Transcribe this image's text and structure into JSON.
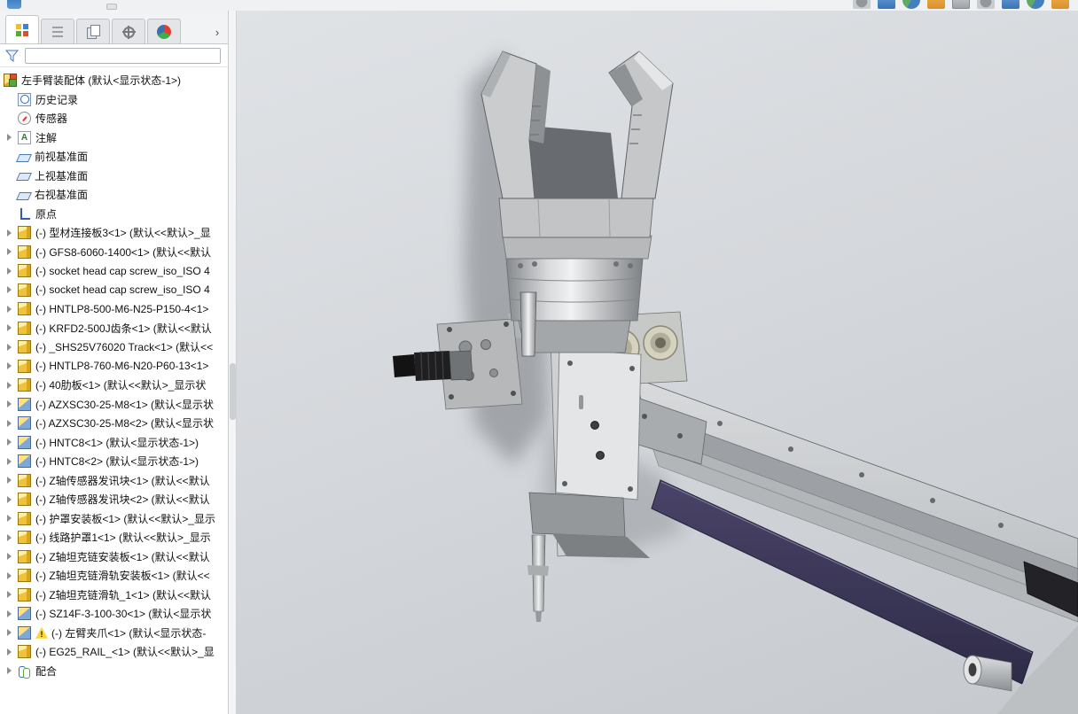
{
  "app": {
    "name": "SolidWorks FeatureManager with 3D assembly viewport"
  },
  "top_strip": {
    "cropped_icon_count": 9
  },
  "panel": {
    "tabs": [
      {
        "id": "featuremanager",
        "active": true
      },
      {
        "id": "propertymanager",
        "active": false
      },
      {
        "id": "configurationmanager",
        "active": false
      },
      {
        "id": "dimxpertmanager",
        "active": false
      },
      {
        "id": "displaymanager",
        "active": false
      }
    ],
    "tab_overflow": "›",
    "filter": {
      "value": "",
      "placeholder": ""
    },
    "tree": [
      {
        "icon": "assembly",
        "label": "左手臂装配体 (默认<显示状态-1>)",
        "root": true
      },
      {
        "icon": "history",
        "label": "历史记录"
      },
      {
        "icon": "sensors",
        "label": "传感器"
      },
      {
        "icon": "annotations",
        "label": "注解",
        "expander": true
      },
      {
        "icon": "plane",
        "label": "前视基准面"
      },
      {
        "icon": "plane",
        "label": "上视基准面"
      },
      {
        "icon": "plane",
        "label": "右视基准面"
      },
      {
        "icon": "origin",
        "label": "原点"
      },
      {
        "icon": "part",
        "label": "(-) 型材连接板3<1> (默认<<默认>_显",
        "expander": true
      },
      {
        "icon": "part",
        "label": "(-) GFS8-6060-1400<1> (默认<<默认",
        "expander": true
      },
      {
        "icon": "part",
        "label": "(-) socket head cap screw_iso_ISO 4",
        "expander": true
      },
      {
        "icon": "part",
        "label": "(-) socket head cap screw_iso_ISO 4",
        "expander": true
      },
      {
        "icon": "part",
        "label": "(-) HNTLP8-500-M6-N25-P150-4<1>",
        "expander": true
      },
      {
        "icon": "part",
        "label": "(-) KRFD2-500J齿条<1> (默认<<默认",
        "expander": true
      },
      {
        "icon": "part",
        "label": "(-) _SHS25V76020 Track<1> (默认<<",
        "expander": true
      },
      {
        "icon": "part",
        "label": "(-) HNTLP8-760-M6-N20-P60-13<1>",
        "expander": true
      },
      {
        "icon": "part",
        "label": "(-) 40肋板<1> (默认<<默认>_显示状",
        "expander": true
      },
      {
        "icon": "part-blue",
        "label": "(-) AZXSC30-25-M8<1> (默认<显示状",
        "expander": true
      },
      {
        "icon": "part-blue",
        "label": "(-) AZXSC30-25-M8<2> (默认<显示状",
        "expander": true
      },
      {
        "icon": "part-blue",
        "label": "(-) HNTC8<1> (默认<显示状态-1>)",
        "expander": true
      },
      {
        "icon": "part-blue",
        "label": "(-) HNTC8<2> (默认<显示状态-1>)",
        "expander": true
      },
      {
        "icon": "part",
        "label": "(-) Z轴传感器发讯块<1> (默认<<默认",
        "expander": true
      },
      {
        "icon": "part",
        "label": "(-) Z轴传感器发讯块<2> (默认<<默认",
        "expander": true
      },
      {
        "icon": "part",
        "label": "(-) 护罩安装板<1> (默认<<默认>_显示",
        "expander": true
      },
      {
        "icon": "part",
        "label": "(-) 线路护罩1<1> (默认<<默认>_显示",
        "expander": true
      },
      {
        "icon": "part",
        "label": "(-) Z轴坦克链安装板<1> (默认<<默认",
        "expander": true
      },
      {
        "icon": "part",
        "label": "(-) Z轴坦克链滑轨安装板<1> (默认<<",
        "expander": true
      },
      {
        "icon": "part",
        "label": "(-) Z轴坦克链滑轨_1<1> (默认<<默认",
        "expander": true
      },
      {
        "icon": "part-blue",
        "label": "(-) SZ14F-3-100-30<1> (默认<显示状",
        "expander": true
      },
      {
        "icon": "part-blue",
        "label": "(-) 左臂夹爪<1> (默认<显示状态-",
        "expander": true,
        "warning": true
      },
      {
        "icon": "part",
        "label": "(-) EG25_RAIL_<1> (默认<<默认>_显",
        "expander": true
      },
      {
        "icon": "mates",
        "label": "配合",
        "expander": true
      }
    ]
  },
  "viewport": {
    "model_name": "left-arm-gripper-rail-assembly",
    "background": "#d5d8dc",
    "accent_colors": {
      "rail_cover": "#3a3657",
      "metal": "#c7c9cb",
      "dark_parts": "#1f1f22"
    }
  }
}
